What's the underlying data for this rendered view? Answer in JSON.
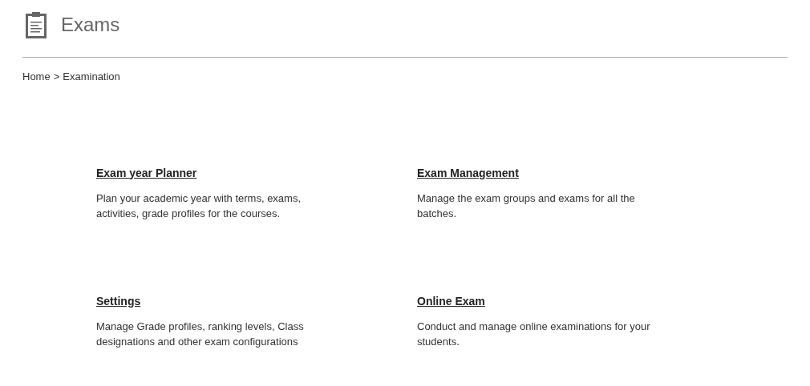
{
  "header": {
    "title": "Exams"
  },
  "breadcrumb": [
    {
      "label": "Home"
    },
    {
      "label": ">"
    },
    {
      "label": "Examination"
    }
  ],
  "cards": [
    {
      "title": "Exam year Planner",
      "description": "Plan your academic year with terms, exams, activities, grade profiles for the courses."
    },
    {
      "title": "Exam Management",
      "description": "Manage the exam groups and exams for all the batches."
    },
    {
      "title": "Settings",
      "description": "Manage Grade profiles, ranking levels, Class designations and other exam configurations"
    },
    {
      "title": "Online Exam",
      "description": "Conduct and manage online examinations for your students."
    }
  ]
}
